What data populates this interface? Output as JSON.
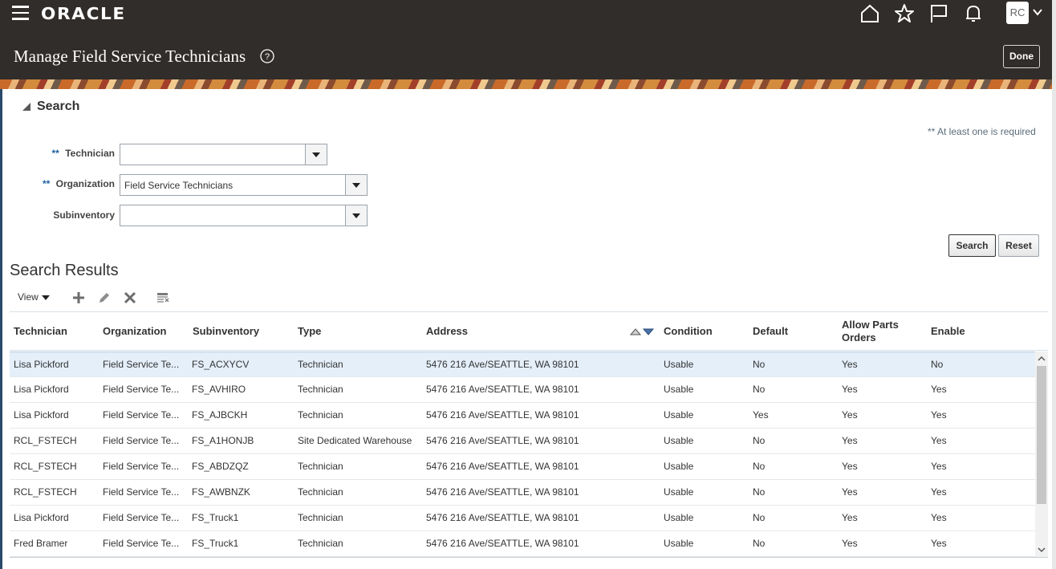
{
  "header": {
    "logo": "ORACLE",
    "avatar_initials": "RC",
    "page_title": "Manage Field Service Technicians",
    "done_label": "Done",
    "icons": [
      "menu-icon",
      "home-icon",
      "favorites-star-icon",
      "flag-icon",
      "notifications-bell-icon",
      "chevron-down-icon",
      "help-icon"
    ]
  },
  "search": {
    "title": "Search",
    "required_note": "** At least one is required",
    "required_marker": "**",
    "fields": {
      "technician": {
        "label": "Technician",
        "value": ""
      },
      "organization": {
        "label": "Organization",
        "value": "Field Service Technicians"
      },
      "subinventory": {
        "label": "Subinventory",
        "value": ""
      }
    },
    "search_label": "Search",
    "reset_label": "Reset"
  },
  "results": {
    "title": "Search Results",
    "view_label": "View",
    "toolbar_icons": [
      "add-icon",
      "edit-pencil-icon",
      "delete-x-icon",
      "freeze-columns-icon"
    ],
    "columns": {
      "technician": "Technician",
      "organization": "Organization",
      "subinventory": "Subinventory",
      "type": "Type",
      "address": "Address",
      "condition": "Condition",
      "default": "Default",
      "allow_parts_orders": "Allow Parts Orders",
      "enable": "Enable"
    },
    "rows": [
      {
        "technician": "Lisa Pickford",
        "organization": "Field Service Te...",
        "subinventory": "FS_ACXYCV",
        "type": "Technician",
        "address": "5476 216 Ave/SEATTLE, WA 98101",
        "condition": "Usable",
        "default": "No",
        "allow_parts_orders": "Yes",
        "enable": "No"
      },
      {
        "technician": "Lisa Pickford",
        "organization": "Field Service Te...",
        "subinventory": "FS_AVHIRO",
        "type": "Technician",
        "address": "5476 216 Ave/SEATTLE, WA 98101",
        "condition": "Usable",
        "default": "No",
        "allow_parts_orders": "Yes",
        "enable": "Yes"
      },
      {
        "technician": "Lisa Pickford",
        "organization": "Field Service Te...",
        "subinventory": "FS_AJBCKH",
        "type": "Technician",
        "address": "5476 216 Ave/SEATTLE, WA 98101",
        "condition": "Usable",
        "default": "Yes",
        "allow_parts_orders": "Yes",
        "enable": "Yes"
      },
      {
        "technician": "RCL_FSTECH",
        "organization": "Field Service Te...",
        "subinventory": "FS_A1HONJB",
        "type": "Site Dedicated Warehouse",
        "address": "5476 216 Ave/SEATTLE, WA 98101",
        "condition": "Usable",
        "default": "No",
        "allow_parts_orders": "Yes",
        "enable": "Yes"
      },
      {
        "technician": "RCL_FSTECH",
        "organization": "Field Service Te...",
        "subinventory": "FS_ABDZQZ",
        "type": "Technician",
        "address": "5476 216 Ave/SEATTLE, WA 98101",
        "condition": "Usable",
        "default": "No",
        "allow_parts_orders": "Yes",
        "enable": "Yes"
      },
      {
        "technician": "RCL_FSTECH",
        "organization": "Field Service Te...",
        "subinventory": "FS_AWBNZK",
        "type": "Technician",
        "address": "5476 216 Ave/SEATTLE, WA 98101",
        "condition": "Usable",
        "default": "No",
        "allow_parts_orders": "Yes",
        "enable": "Yes"
      },
      {
        "technician": "Lisa Pickford",
        "organization": "Field Service Te...",
        "subinventory": "FS_Truck1",
        "type": "Technician",
        "address": "5476 216 Ave/SEATTLE, WA 98101",
        "condition": "Usable",
        "default": "No",
        "allow_parts_orders": "Yes",
        "enable": "Yes"
      },
      {
        "technician": "Fred Bramer",
        "organization": "Field Service Te...",
        "subinventory": "FS_Truck1",
        "type": "Technician",
        "address": "5476 216 Ave/SEATTLE, WA 98101",
        "condition": "Usable",
        "default": "No",
        "allow_parts_orders": "Yes",
        "enable": "Yes"
      }
    ]
  }
}
